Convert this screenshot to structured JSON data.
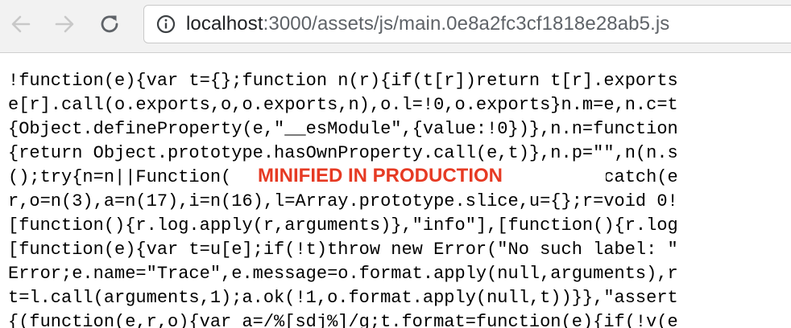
{
  "browser": {
    "url_host": "localhost",
    "url_rest": ":3000/assets/js/main.0e8a2fc3cf1818e28ab5.js",
    "back_icon": "arrow-left-icon",
    "forward_icon": "arrow-right-icon",
    "reload_icon": "reload-icon",
    "info_icon": "info-icon"
  },
  "code_lines": [
    "!function(e){var t={};function n(r){if(t[r])return t[r].exports",
    "e[r].call(o.exports,o,o.exports,n),o.l=!0,o.exports}n.m=e,n.c=t",
    "{Object.defineProperty(e,\"__esModule\",{value:!0})},n.n=function",
    "{return Object.prototype.hasOwnProperty.call(e,t)},n.p=\"\",n(n.s",
    "();try{n=n||Function(\"return this\")()||(0,eval)(\"this\")}catch(e",
    "r,o=n(3),a=n(17),i=n(16),l=Array.prototype.slice,u={};r=void 0!",
    "[function(){r.log.apply(r,arguments)},\"info\"],[function(){r.log",
    "[function(e){var t=u[e];if(!t)throw new Error(\"No such label: \"",
    "Error;e.name=\"Trace\",e.message=o.format.apply(null,arguments),r",
    "t=l.call(arguments,1);a.ok(!1,o.format.apply(null,t))}},\"assert",
    "{(function(e,r,o){var a=/%[sdj%]/g;t.format=function(e){if(!v(e"
  ],
  "overlay": {
    "label": "MINIFIED IN PRODUCTION",
    "color": "#e63a23"
  }
}
